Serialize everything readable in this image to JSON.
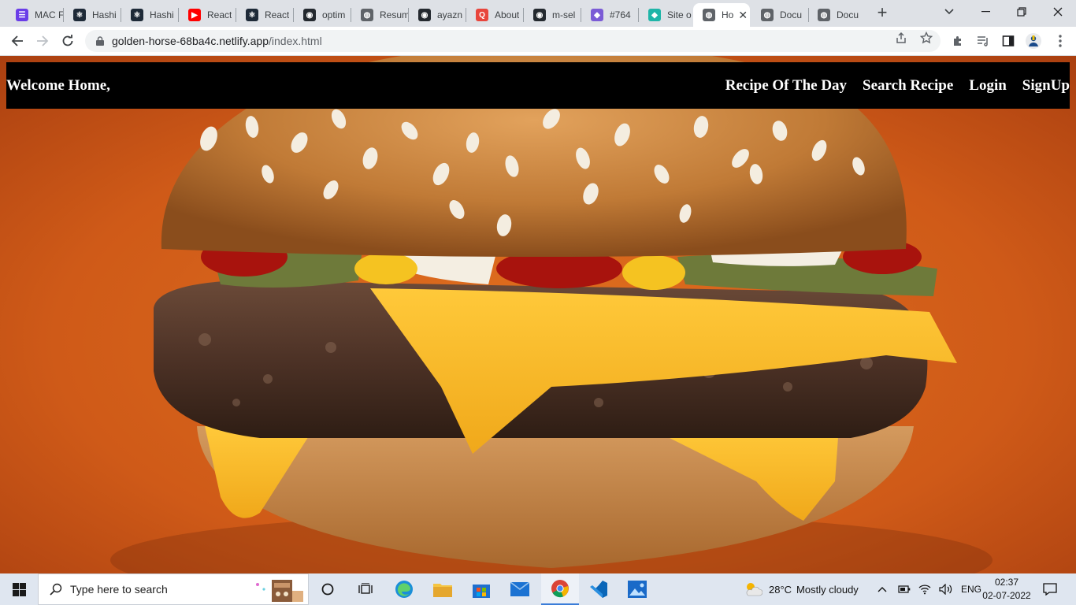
{
  "tabs": [
    {
      "title": "MAC F",
      "icon": "list-icon",
      "color": "#6a3de8"
    },
    {
      "title": "Hashi",
      "icon": "react-icon",
      "color": "#1e2a38"
    },
    {
      "title": "Hashi",
      "icon": "react-icon",
      "color": "#1e2a38"
    },
    {
      "title": "React",
      "icon": "youtube-icon",
      "color": "#ff0000"
    },
    {
      "title": "React",
      "icon": "react-icon",
      "color": "#1e2a38"
    },
    {
      "title": "optim",
      "icon": "github-icon",
      "color": "#24292f"
    },
    {
      "title": "Resum",
      "icon": "globe-icon",
      "color": "#5f6368"
    },
    {
      "title": "ayazn",
      "icon": "github-icon",
      "color": "#24292f"
    },
    {
      "title": "About",
      "icon": "quora-icon",
      "color": "#e8453c"
    },
    {
      "title": "m-sel",
      "icon": "github-icon",
      "color": "#24292f"
    },
    {
      "title": "#764",
      "icon": "discord-icon",
      "color": "#7b5bd6"
    },
    {
      "title": "Site o",
      "icon": "netlify-icon",
      "color": "#1fb5a8"
    },
    {
      "title": "Ho",
      "icon": "globe-icon",
      "color": "#5f6368",
      "active": true
    },
    {
      "title": "Docu",
      "icon": "globe-icon",
      "color": "#5f6368"
    },
    {
      "title": "Docu",
      "icon": "globe-icon",
      "color": "#5f6368"
    }
  ],
  "address": {
    "host": "golden-horse-68ba4c.netlify.app",
    "path": "/index.html"
  },
  "site": {
    "brand": "Welcome Home,",
    "nav": [
      "Recipe Of The Day",
      "Search Recipe",
      "Login",
      "SignUp"
    ]
  },
  "taskbar": {
    "search_placeholder": "Type here to search",
    "weather_temp": "28°C",
    "weather_desc": "Mostly cloudy",
    "lang": "ENG",
    "time": "02:37",
    "date": "02-07-2022"
  }
}
